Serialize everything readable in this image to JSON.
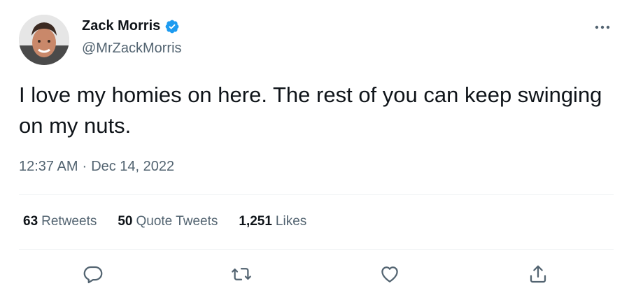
{
  "author": {
    "display_name": "Zack Morris",
    "handle": "@MrZackMorris",
    "verified": true
  },
  "tweet": {
    "text": "I love my homies on here. The rest of you can keep swinging on my nuts.",
    "time": "12:37 AM",
    "separator": "·",
    "date": "Dec 14, 2022"
  },
  "stats": {
    "retweets_count": "63",
    "retweets_label": "Retweets",
    "quotes_count": "50",
    "quotes_label": "Quote Tweets",
    "likes_count": "1,251",
    "likes_label": "Likes"
  },
  "colors": {
    "verified_blue": "#1d9bf0",
    "secondary_text": "#536471",
    "primary_text": "#0f1419",
    "divider": "#eff3f4"
  },
  "icons": {
    "more": "more-horizontal-icon",
    "reply": "reply-icon",
    "retweet": "retweet-icon",
    "like": "heart-icon",
    "share": "share-icon",
    "verified": "verified-badge-icon"
  }
}
